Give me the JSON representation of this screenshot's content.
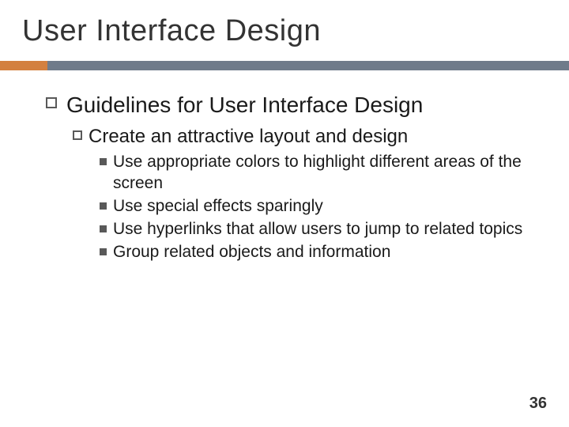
{
  "title": "User Interface Design",
  "heading": "Guidelines for User Interface Design",
  "subpoint": "Create an attractive layout and design",
  "bullets": [
    "Use appropriate colors to highlight different areas of the screen",
    "Use special effects sparingly",
    "Use hyperlinks that allow users to jump to related topics",
    "Group related objects and information"
  ],
  "page_number": "36"
}
